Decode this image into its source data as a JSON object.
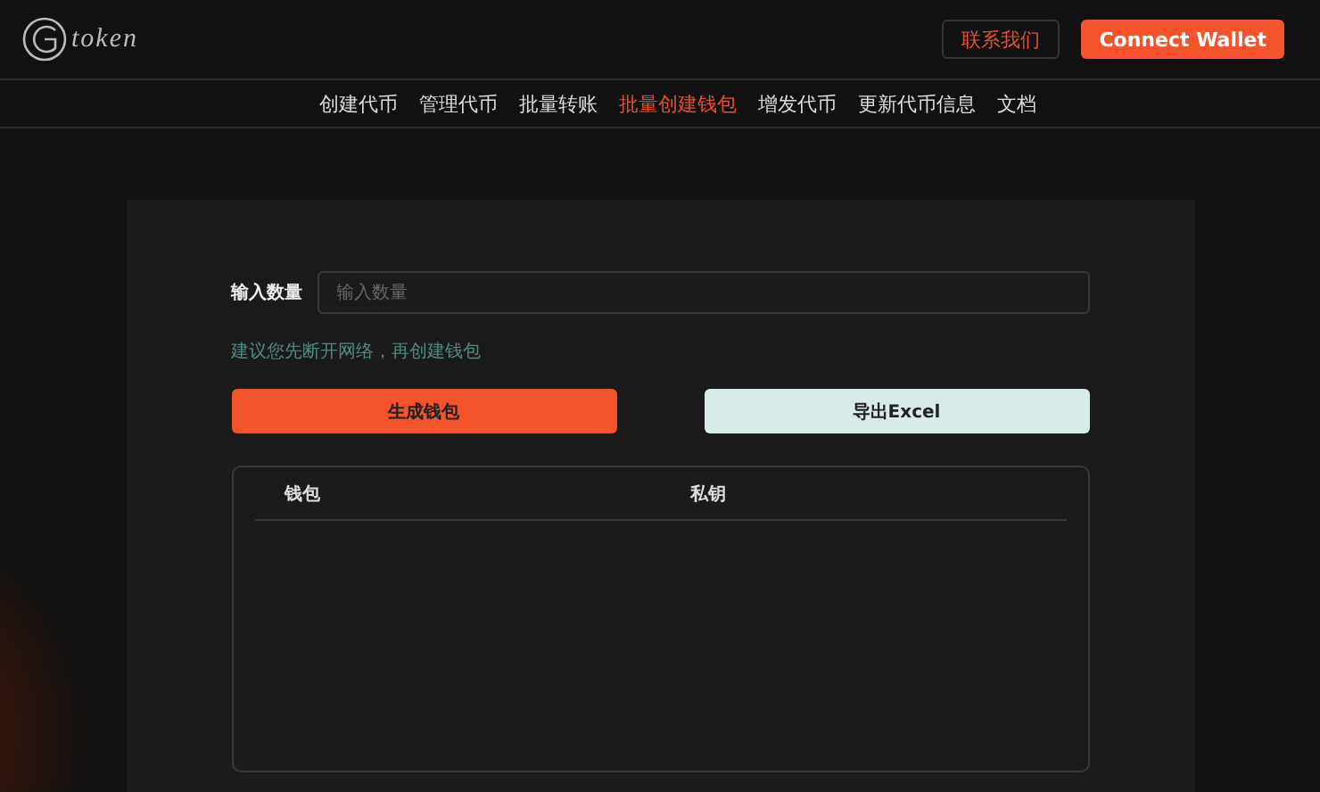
{
  "header": {
    "logo_text": "token",
    "contact_button": "联系我们",
    "connect_button": "Connect Wallet"
  },
  "nav": [
    {
      "label": "创建代币",
      "selected": false
    },
    {
      "label": "管理代币",
      "selected": false
    },
    {
      "label": "批量转账",
      "selected": false
    },
    {
      "label": "批量创建钱包",
      "selected": true
    },
    {
      "label": "增发代币",
      "selected": false
    },
    {
      "label": "更新代币信息",
      "selected": false
    },
    {
      "label": "文档",
      "selected": false
    }
  ],
  "form": {
    "quantity_label": "输入数量",
    "quantity_placeholder": "输入数量",
    "hint": "建议您先断开网络，再创建钱包",
    "generate_button": "生成钱包",
    "export_button": "导出Excel"
  },
  "table": {
    "columns": [
      "钱包",
      "私钥"
    ]
  }
}
